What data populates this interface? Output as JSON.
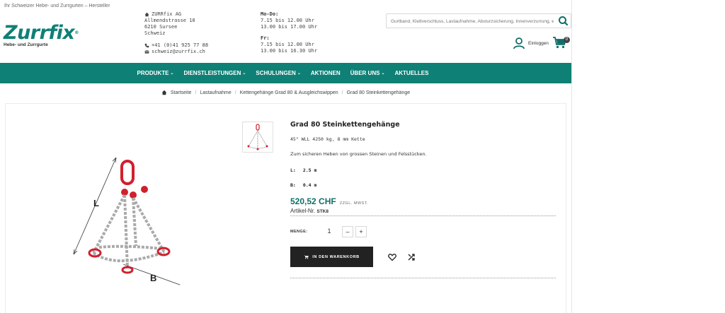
{
  "header": {
    "tagline": "Ihr Schweizer Hebe- und Zurrgurten – Hersteller",
    "logo_word": "Zurrfix",
    "logo_reg": "®",
    "logo_sub": "Hebe- und Zurrgurte",
    "address": {
      "company": "ZURRfix AG",
      "street": "Allmendstrasse 10",
      "city": "6210 Sursee",
      "country": "Schweiz",
      "phone": "+41 (0)41 925 77 88",
      "email": "schweiz@zurrfix.ch"
    },
    "hours": {
      "label1": "Mo-Do:",
      "line1a": "7.15 bis 12.00 Uhr",
      "line1b": "13.00 bis 17.00 Uhr",
      "label2": "Fr:",
      "line2a": "7.15 bis 12.00 Uhr",
      "line2b": "13.00 bis 16.30 Uhr"
    },
    "search_placeholder": "Gurtband, Klettverschluss, Lastaufnahme, Absturzsicherung, Innenverzurrung, etc ...",
    "login_label": "Einloggen",
    "cart_count": "0"
  },
  "nav": [
    {
      "label": "Produkte",
      "chevron": true
    },
    {
      "label": "Dienstleistungen",
      "chevron": true
    },
    {
      "label": "Schulungen",
      "chevron": true
    },
    {
      "label": "Aktionen",
      "chevron": false
    },
    {
      "label": "Über uns",
      "chevron": true
    },
    {
      "label": "Aktuelles",
      "chevron": false
    }
  ],
  "breadcrumb": {
    "home": "Startseite",
    "c1": "Lastaufnahme",
    "c2": "Kettengehänge Grad 80 & Ausgleichswippen",
    "c3": "Grad 80 Steinkettengehänge",
    "sep": "/"
  },
  "image": {
    "label_l": "L",
    "label_b": "B"
  },
  "product": {
    "title": "Grad 80 Steinkettengehänge",
    "subtitle": "45° WLL 4250 kg, 8 mm Kette",
    "description": "Zum sicheren Heben von grossen Steinen und Felsstücken.",
    "attr_l_label": "L:",
    "attr_l_value": "2.5 m",
    "attr_b_label": "B:",
    "attr_b_value": "0.4 m",
    "price": "520,52 CHF",
    "vat": "ZZGL. MWST.",
    "artnr_label": "Artikel-Nr.",
    "artnr_value": "STK8",
    "qty_label": "MENGE:",
    "qty_value": "1",
    "minus": "–",
    "plus": "+",
    "add_to_cart": "IN DEN WARENKORB"
  },
  "colors": {
    "brand": "#0f8076",
    "price": "#0f6f68",
    "button": "#222222",
    "chain_red": "#d0202e"
  }
}
